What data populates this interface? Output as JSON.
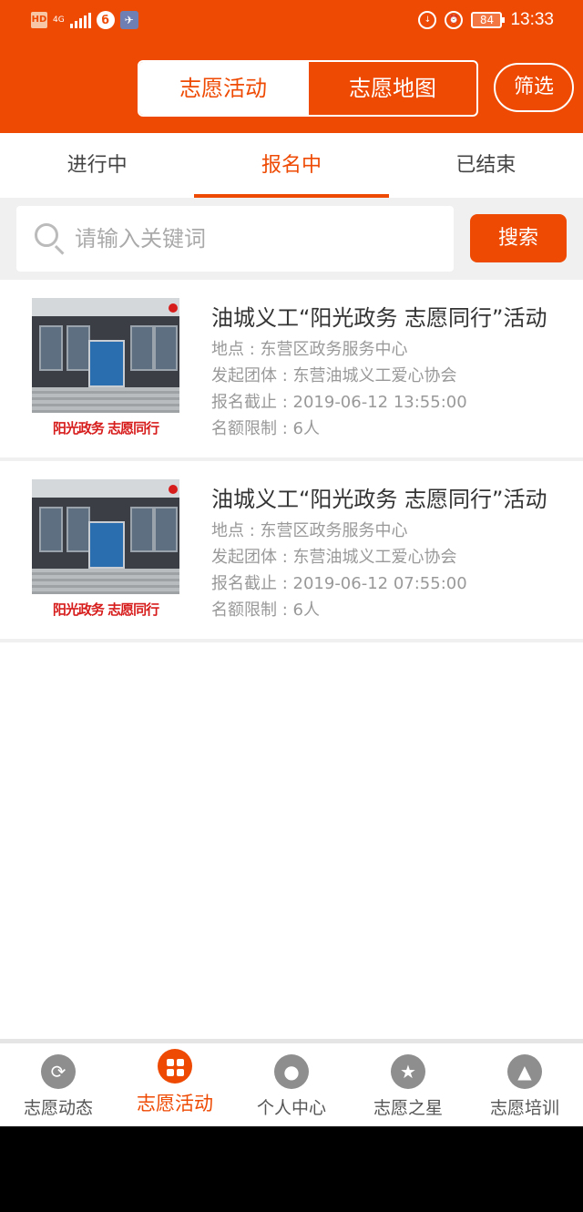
{
  "status_bar": {
    "hd": "HD",
    "network": "4G",
    "battery": "84",
    "time": "13:33"
  },
  "header": {
    "segments": [
      "志愿活动",
      "志愿地图"
    ],
    "filter_label": "筛选"
  },
  "tabs": [
    {
      "label": "进行中"
    },
    {
      "label": "报名中"
    },
    {
      "label": "已结束"
    }
  ],
  "search": {
    "placeholder": "请输入关键词",
    "button_label": "搜索"
  },
  "activities": [
    {
      "title": "油城义工“阳光政务 志愿同行”活动",
      "location": "地点 : 东营区政务服务中心",
      "organizer": "发起团体 : 东营油城义工爱心协会",
      "deadline": "报名截止 : 2019-06-12 13:55:00",
      "quota": "名额限制 : 6人",
      "thumb_text": "阳光政务 志愿同行"
    },
    {
      "title": "油城义工“阳光政务 志愿同行”活动",
      "location": "地点 : 东营区政务服务中心",
      "organizer": "发起团体 : 东营油城义工爱心协会",
      "deadline": "报名截止 : 2019-06-12 07:55:00",
      "quota": "名额限制 : 6人",
      "thumb_text": "阳光政务 志愿同行"
    }
  ],
  "bottom_nav": [
    {
      "label": "志愿动态",
      "icon": "refresh-icon"
    },
    {
      "label": "志愿活动",
      "icon": "grid-icon"
    },
    {
      "label": "个人中心",
      "icon": "person-icon"
    },
    {
      "label": "志愿之星",
      "icon": "star-icon"
    },
    {
      "label": "志愿培训",
      "icon": "graduation-cap-icon"
    }
  ],
  "colors": {
    "accent": "#ee4a03",
    "background_gray": "#f0f0f0",
    "text_muted": "#999999"
  }
}
